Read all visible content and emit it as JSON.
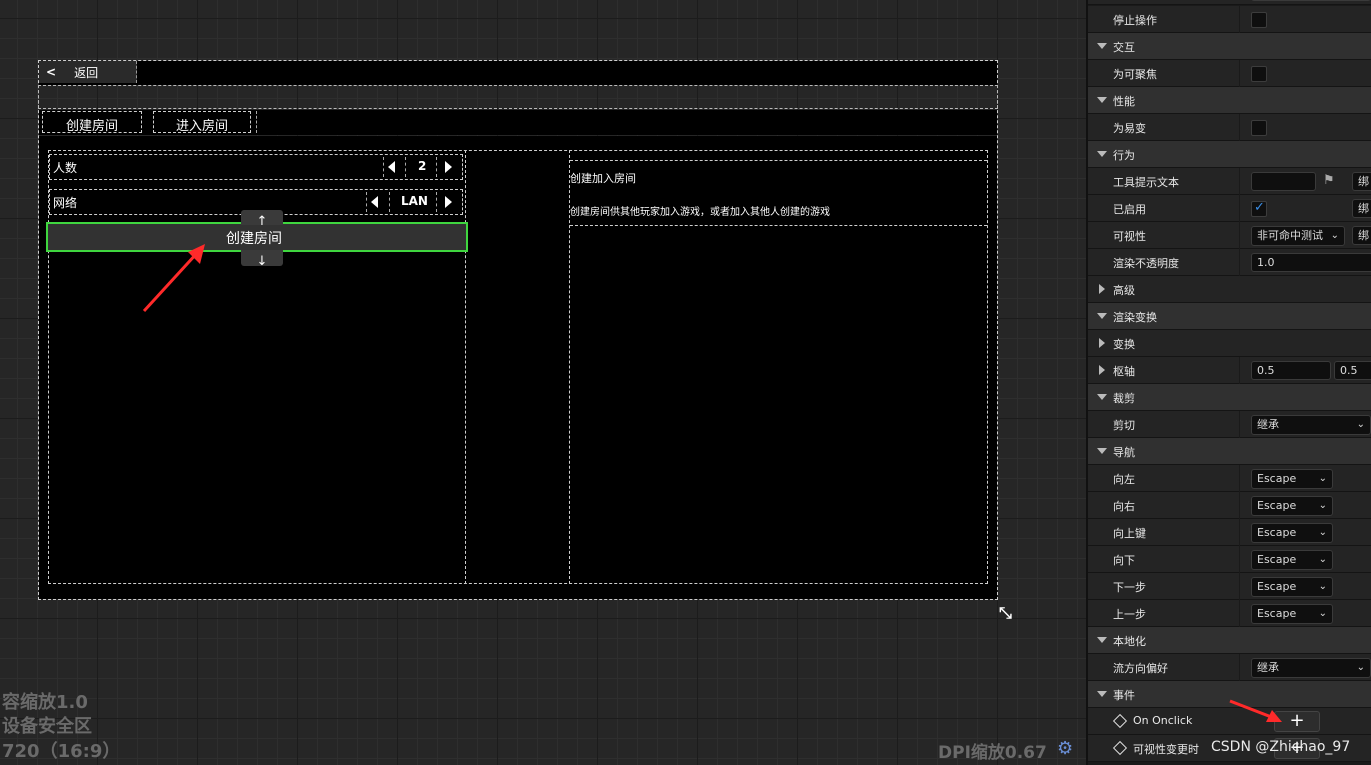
{
  "canvas": {
    "back_button": {
      "arrow": "<",
      "label": "返回"
    },
    "tabs": [
      "创建房间",
      "进入房间"
    ],
    "players_row": {
      "label": "人数",
      "value": "2"
    },
    "network_row": {
      "label": "网络",
      "value": "LAN"
    },
    "create_button": {
      "label": "创建房间",
      "up_glyph": "↑",
      "down_glyph": "↓",
      "selected_color": "#3fd63f"
    },
    "info": {
      "title": "创建加入房间",
      "description": "创建房间供其他玩家加入游戏，或者加入其他人创建的游戏"
    },
    "bottom_left_overlay": [
      "容缩放1.0",
      "设备安全区",
      "720（16:9）"
    ],
    "dpi_label": "DPI缩放0.67",
    "annotation_arrow_color": "#ff2a2a"
  },
  "panel": {
    "rows": {
      "stop_action": "停止操作",
      "interaction": "交互",
      "focusable": "为可聚焦",
      "performance": "性能",
      "volatile": "为易变",
      "behavior": "行为",
      "tooltip_text": "工具提示文本",
      "enabled": "已启用",
      "visibility": "可视性",
      "visibility_value": "非可命中测试",
      "render_opacity": "渲染不透明度",
      "render_opacity_value": "1.0",
      "advanced": "高级",
      "render_transform": "渲染变换",
      "transform": "变换",
      "pivot": "枢轴",
      "pivot_x": "0.5",
      "pivot_y": "0.5",
      "clipping": "裁剪",
      "clip": "剪切",
      "clip_value": "继承",
      "navigation": "导航",
      "nav_left": "向左",
      "nav_right": "向右",
      "nav_up": "向上键",
      "nav_down": "向下",
      "nav_next": "下一步",
      "nav_prev": "上一步",
      "nav_value": "Escape",
      "localization": "本地化",
      "flow_direction": "流方向偏好",
      "flow_value": "继承",
      "events": "事件",
      "on_onclick": "On Onclick",
      "on_visibility_changed": "可视性变更时",
      "bind_label": "绑"
    }
  },
  "watermark": "CSDN @Zhichao_97"
}
